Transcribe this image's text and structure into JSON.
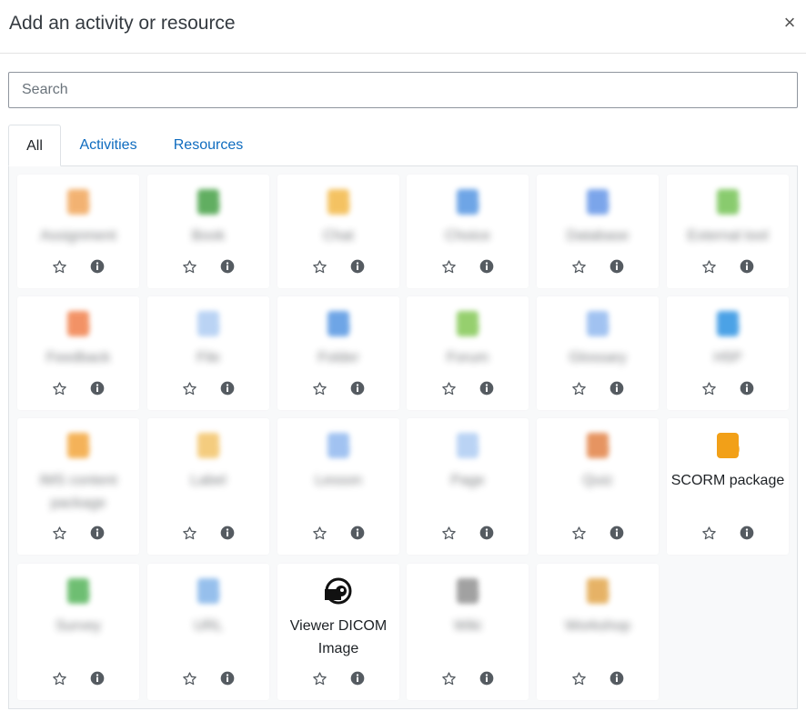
{
  "modal": {
    "title": "Add an activity or resource",
    "close_glyph": "×"
  },
  "search": {
    "placeholder": "Search",
    "value": ""
  },
  "tabs": [
    {
      "label": "All",
      "active": true
    },
    {
      "label": "Activities",
      "active": false
    },
    {
      "label": "Resources",
      "active": false
    }
  ],
  "items": [
    {
      "label": "Assignment",
      "icon": "assignment-icon",
      "color": "#f0a050",
      "blurred": true
    },
    {
      "label": "Book",
      "icon": "book-icon",
      "color": "#3a9a3a",
      "blurred": true
    },
    {
      "label": "Chat",
      "icon": "chat-icon",
      "color": "#f2b43c",
      "blurred": true
    },
    {
      "label": "Choice",
      "icon": "choice-icon",
      "color": "#4a8fe0",
      "blurred": true
    },
    {
      "label": "Database",
      "icon": "database-icon",
      "color": "#5b8fe6",
      "blurred": true
    },
    {
      "label": "External tool",
      "icon": "external-tool-icon",
      "color": "#6cbf4a",
      "blurred": true
    },
    {
      "label": "Feedback",
      "icon": "feedback-icon",
      "color": "#f07840",
      "blurred": true
    },
    {
      "label": "File",
      "icon": "file-icon",
      "color": "#a9c9f2",
      "blurred": true
    },
    {
      "label": "Folder",
      "icon": "folder-icon",
      "color": "#4a8fe0",
      "blurred": true
    },
    {
      "label": "Forum",
      "icon": "forum-icon",
      "color": "#7cc44a",
      "blurred": true
    },
    {
      "label": "Glossary",
      "icon": "glossary-icon",
      "color": "#8ab4ee",
      "blurred": true
    },
    {
      "label": "H5P",
      "icon": "h5p-icon",
      "color": "#1f8be0",
      "blurred": true
    },
    {
      "label": "IMS content package",
      "icon": "ims-package-icon",
      "color": "#f2a030",
      "blurred": true
    },
    {
      "label": "Label",
      "icon": "label-icon",
      "color": "#f2c060",
      "blurred": true
    },
    {
      "label": "Lesson",
      "icon": "lesson-icon",
      "color": "#8ab4ee",
      "blurred": true
    },
    {
      "label": "Page",
      "icon": "page-icon",
      "color": "#a9c9f2",
      "blurred": true
    },
    {
      "label": "Quiz",
      "icon": "quiz-icon",
      "color": "#e07a3a",
      "blurred": true
    },
    {
      "label": "SCORM package",
      "icon": "scorm-icon",
      "color": "#f2a018",
      "blurred": false
    },
    {
      "label": "Survey",
      "icon": "survey-icon",
      "color": "#4caf50",
      "blurred": true
    },
    {
      "label": "URL",
      "icon": "url-icon",
      "color": "#7cb0e8",
      "blurred": true
    },
    {
      "label": "Viewer DICOM Image",
      "icon": "dicom-viewer-icon",
      "color": "#111111",
      "blurred": false
    },
    {
      "label": "Wiki",
      "icon": "wiki-icon",
      "color": "#8a8a8a",
      "blurred": true
    },
    {
      "label": "Workshop",
      "icon": "workshop-icon",
      "color": "#e0a040",
      "blurred": true
    }
  ],
  "colors": {
    "link": "#0f6cbf",
    "border": "#dee2e6",
    "panel_bg": "#f8f9fa",
    "action_icon": "#555b61"
  }
}
